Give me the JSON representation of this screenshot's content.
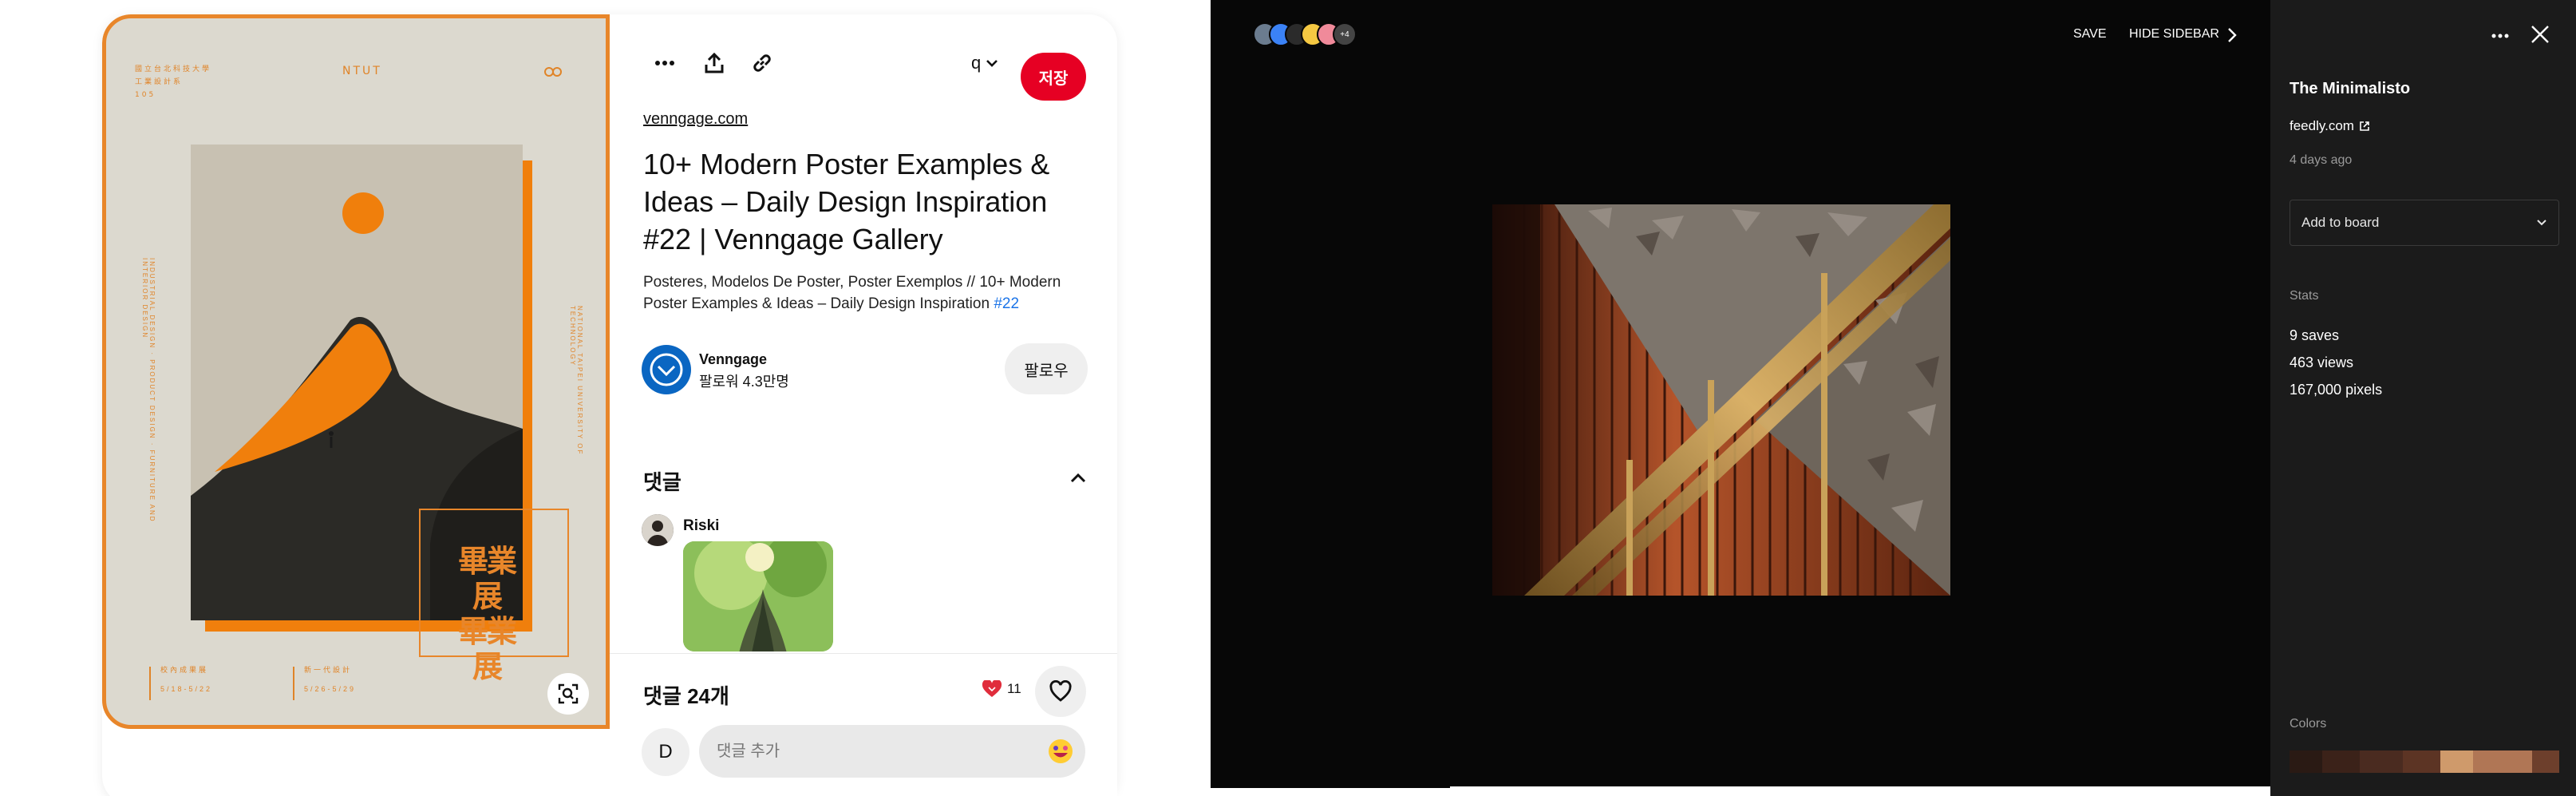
{
  "pin": {
    "poster": {
      "title_cn": "國立台北科技大學\n工業設計系\n105",
      "brand": "NTUT",
      "left_vertical": "INDUSTRIAL DESIGN · PRODUCT DESIGN · FURNITURE AND INTERIOR DESIGN",
      "right_vertical": "NATIONAL TAIPEI UNIVERSITY OF TECHNOLOGY",
      "chars_line1": "畢業展",
      "chars_line2": "畢業展",
      "bottom_left": "校內成果展\n5/18-5/22",
      "bottom_right": "新一代設計\n5/26-5/29"
    },
    "toolbar": {
      "more_label": "more",
      "share_label": "share",
      "link_label": "link",
      "profile_initial": "q",
      "save_label": "저장"
    },
    "source": "venngage.com",
    "title": "10+ Modern Poster Examples & Ideas – Daily Design Inspiration #22 | Venngage Gallery",
    "description_text": "Posteres, Modelos De Poster, Poster Exemplos // 10+ Modern Poster Examples & Ideas – Daily Design Inspiration ",
    "description_tag": "#22",
    "creator": {
      "name": "Venngage",
      "followers": "팔로워 4.3만명",
      "follow_label": "팔로우"
    },
    "comments": {
      "heading": "댓글",
      "first_user": "Riski",
      "count_label": "댓글 24개",
      "reaction_count": "11",
      "me_initial": "D",
      "input_placeholder": "댓글 추가"
    },
    "colors": {
      "save": "#e60023",
      "poster_orange": "#f07f0c",
      "poster_bg": "#dcd9cf"
    }
  },
  "viewer": {
    "avatars_more": "+4",
    "save_label": "SAVE",
    "hide_sidebar_label": "HIDE SIDEBAR",
    "sidebar": {
      "title": "The Minimalisto",
      "domain": "feedly.com",
      "time": "4 days ago",
      "board_placeholder": "Add to board",
      "stats_label": "Stats",
      "saves": "9 saves",
      "views": "463 views",
      "pixels": "167,000 pixels",
      "colors_label": "Colors",
      "palette": [
        "#2a1a14",
        "#3b2219",
        "#4a2b20",
        "#5c3424",
        "#cf9a6b",
        "#b07655",
        "#6d3f2c"
      ]
    }
  }
}
